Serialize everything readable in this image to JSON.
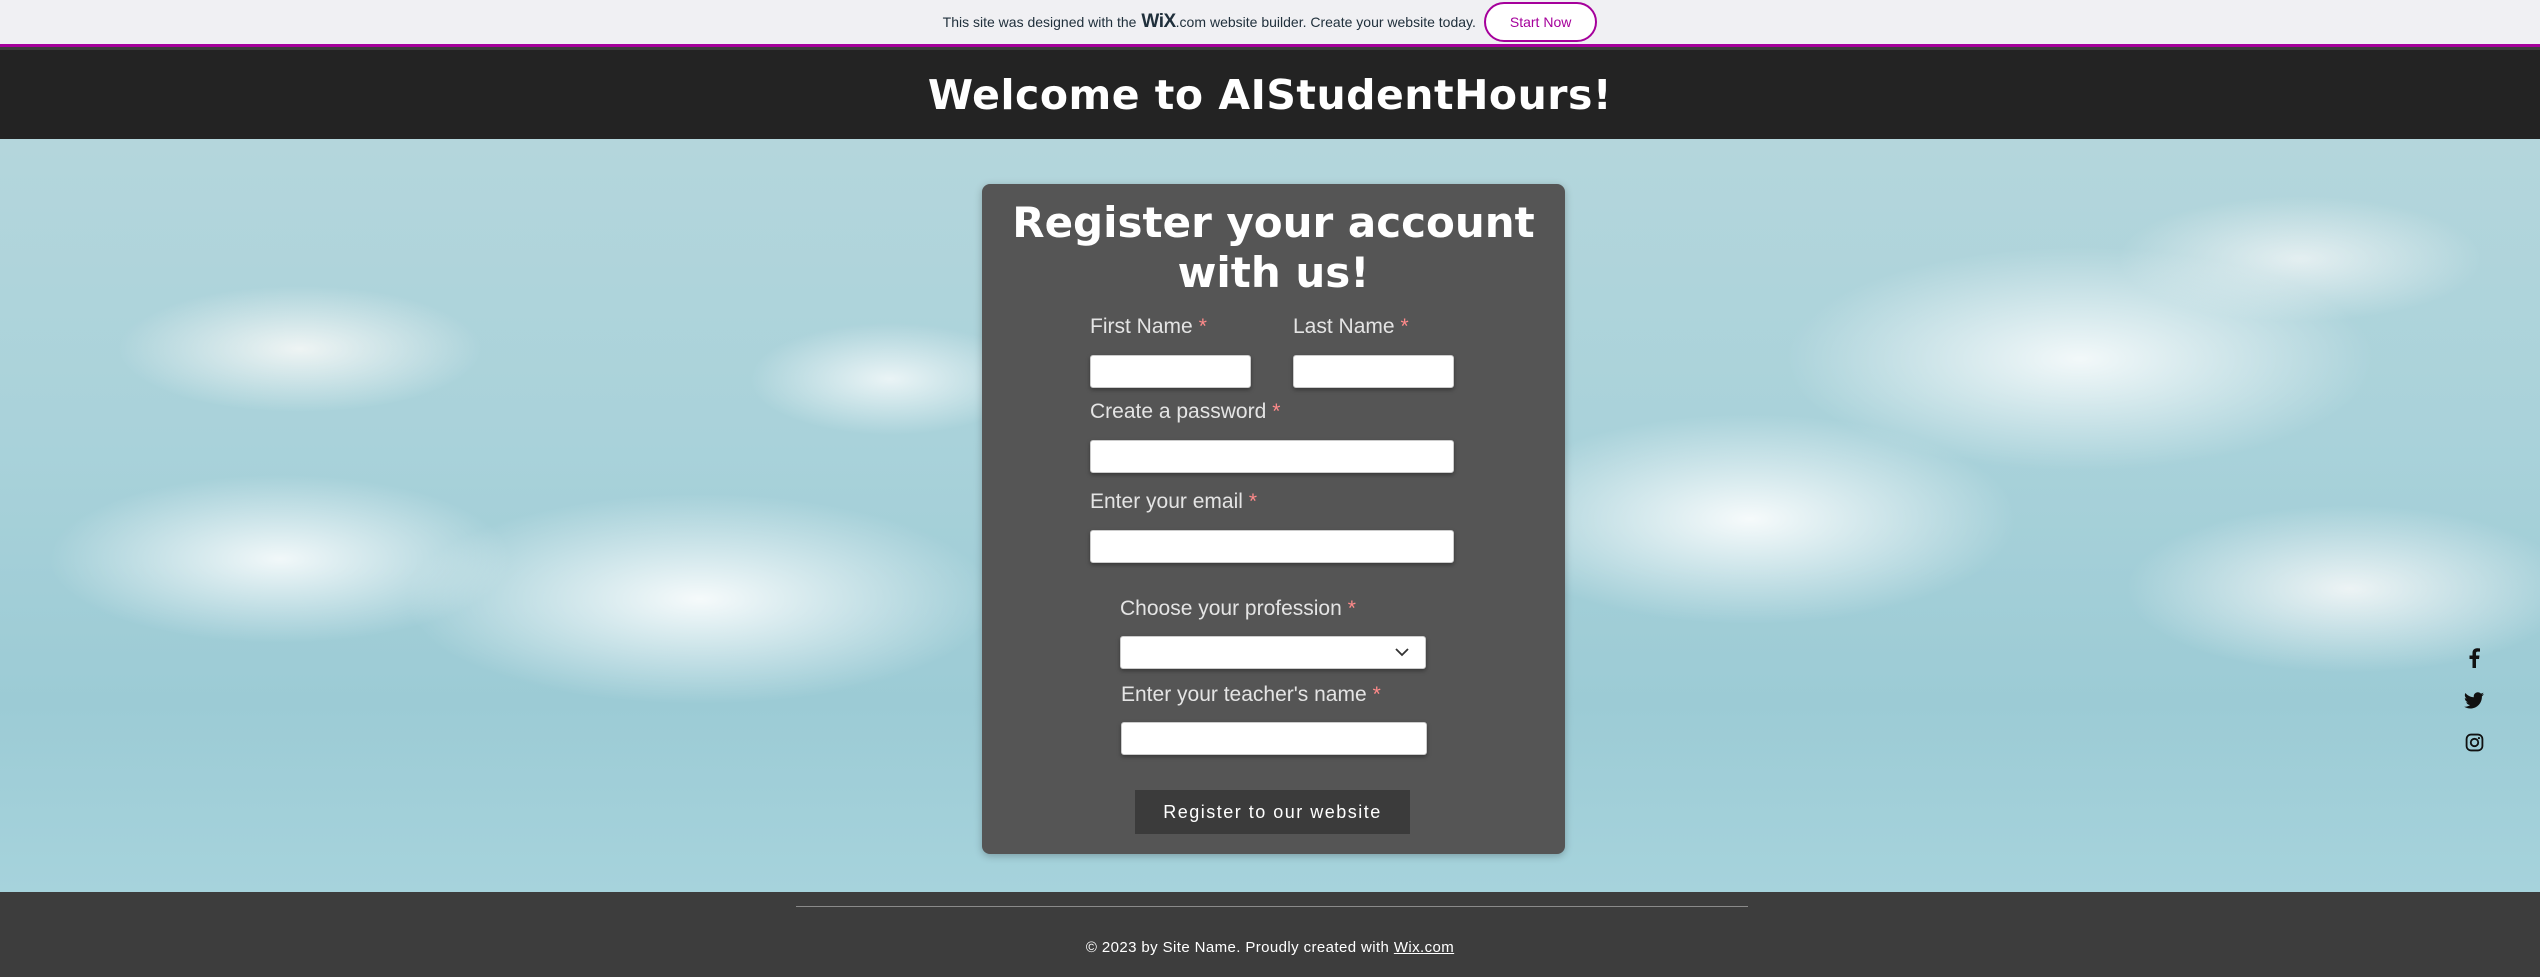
{
  "wix_banner": {
    "text_before": "This site was designed with the",
    "logo": "WiX",
    "logo_suffix": ".com",
    "text_after": "website builder. Create your website today.",
    "cta_label": "Start Now"
  },
  "header": {
    "title": "Welcome to AIStudentHours!"
  },
  "form": {
    "title_line1": "Register your account",
    "title_line2": "with us!",
    "required_mark": "*",
    "fields": {
      "first_name": {
        "label": "First Name",
        "value": ""
      },
      "last_name": {
        "label": "Last Name",
        "value": ""
      },
      "password": {
        "label": "Create a password",
        "value": ""
      },
      "email": {
        "label": "Enter your email",
        "value": ""
      },
      "profession": {
        "label": "Choose your profession",
        "selected": ""
      },
      "teacher": {
        "label": "Enter your teacher's name",
        "value": ""
      }
    },
    "submit_label": "Register to our website"
  },
  "social": {
    "icons": [
      "facebook-icon",
      "twitter-icon",
      "instagram-icon"
    ]
  },
  "footer": {
    "copyright": "© 2023 by Site Name. Proudly created with",
    "link": "Wix.com"
  },
  "colors": {
    "wix_accent": "#a5009b",
    "header_bg": "#232323",
    "card_bg": "#555555",
    "required": "#ff8a8a",
    "footer_bg": "#3d3d3d"
  }
}
